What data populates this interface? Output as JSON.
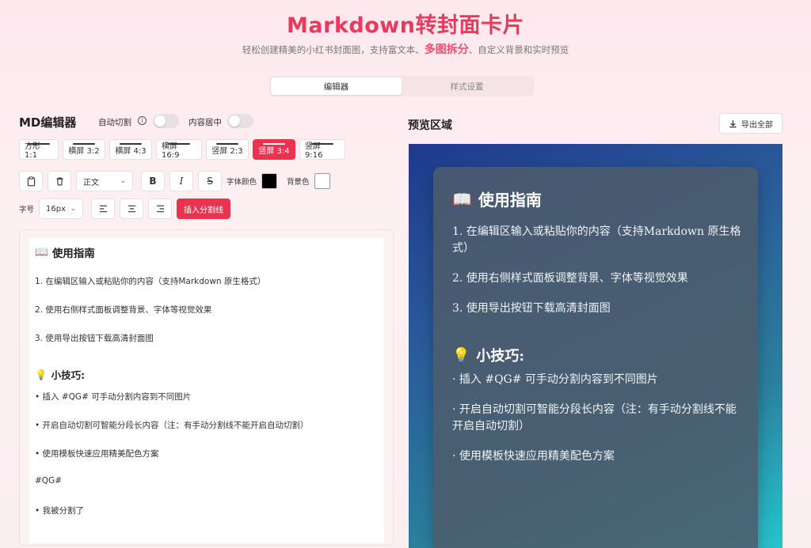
{
  "header": {
    "title": "Markdown转封面卡片",
    "subtitle_before": "轻松创建精美的小红书封面图，支持富文本、",
    "subtitle_highlight": "多图拆分",
    "subtitle_after": "、自定义背景和实时预览"
  },
  "tabs": [
    {
      "label": "编辑器",
      "active": true
    },
    {
      "label": "样式设置",
      "active": false
    }
  ],
  "editor": {
    "title": "MD编辑器",
    "auto_split_label": "自动切割",
    "center_label": "内容居中",
    "ratios": [
      {
        "label": "方形 1:1",
        "active": false
      },
      {
        "label": "横屏 3:2",
        "active": false
      },
      {
        "label": "横屏 4:3",
        "active": false
      },
      {
        "label": "横屏 16:9",
        "active": false
      },
      {
        "label": "竖屏 2:3",
        "active": false
      },
      {
        "label": "竖屏 3:4",
        "active": true
      },
      {
        "label": "竖屏 9:16",
        "active": false
      }
    ],
    "toolbar": {
      "paragraph_select": "正文",
      "bold": "B",
      "italic": "I",
      "strike": "S",
      "font_color_label": "字体颜色",
      "font_color": "#000000",
      "bg_color_label": "背景色",
      "bg_color": "#ffffff",
      "size_label": "字号",
      "size_select": "16px",
      "insert_split": "插入分割线"
    },
    "content": {
      "heading": "使用指南",
      "items": [
        "1. 在编辑区输入或粘贴你的内容（支持Markdown 原生格式）",
        "2. 使用右侧样式面板调整背景、字体等视觉效果",
        "3. 使用导出按钮下载高清封面图"
      ],
      "tips_heading": "小技巧:",
      "tips": [
        "• 插入 #QG# 可手动分割内容到不同图片",
        "• 开启自动切割可智能分段长内容（注：有手动分割线不能开启自动切割）",
        "• 使用模板快速应用精美配色方案"
      ],
      "split_marker": "#QG#",
      "after_split": "• 我被分割了"
    }
  },
  "preview": {
    "title": "预览区域",
    "export_label": "导出全部",
    "card": {
      "heading": "使用指南",
      "items": [
        "1. 在编辑区输入或粘贴你的内容（支持Markdown 原生格式）",
        "2. 使用右侧样式面板调整背景、字体等视觉效果",
        "3. 使用导出按钮下载高清封面图"
      ],
      "tips_heading": "小技巧:",
      "tips": [
        "· 插入 #QG# 可手动分割内容到不同图片",
        "· 开启自动切割可智能分段长内容（注：有手动分割线不能开启自动切割）",
        "· 使用模板快速应用精美配色方案"
      ]
    }
  },
  "colors": {
    "accent": "#e8344f",
    "title": "#e83a5c"
  }
}
